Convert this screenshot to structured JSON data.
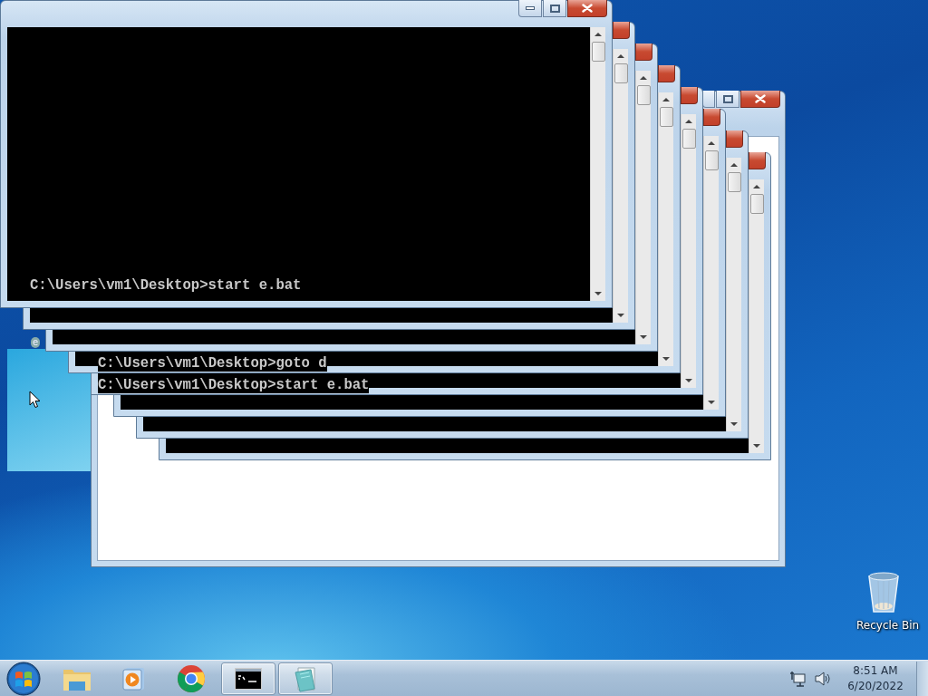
{
  "desktop": {
    "icons": [
      {
        "kind": "file",
        "label": "e"
      },
      {
        "kind": "recycle_bin",
        "label": "Recycle Bin"
      }
    ]
  },
  "console_lines": [
    {
      "text": "C:\\Users\\vm1\\Desktop>start e.bat"
    },
    {
      "text": "C:\\Users\\vm1\\Desktop>goto d"
    },
    {
      "text": "C:\\Users\\vm1\\Desktop>start e.bat"
    }
  ],
  "taskbar": {
    "items": [
      {
        "kind": "start",
        "active": false
      },
      {
        "kind": "explorer",
        "active": false
      },
      {
        "kind": "media_player",
        "active": false
      },
      {
        "kind": "browser",
        "active": false
      },
      {
        "kind": "console",
        "active": true
      },
      {
        "kind": "notepad",
        "active": true
      }
    ],
    "clock": {
      "time": "8:51 AM",
      "date": "6/20/2022"
    }
  }
}
